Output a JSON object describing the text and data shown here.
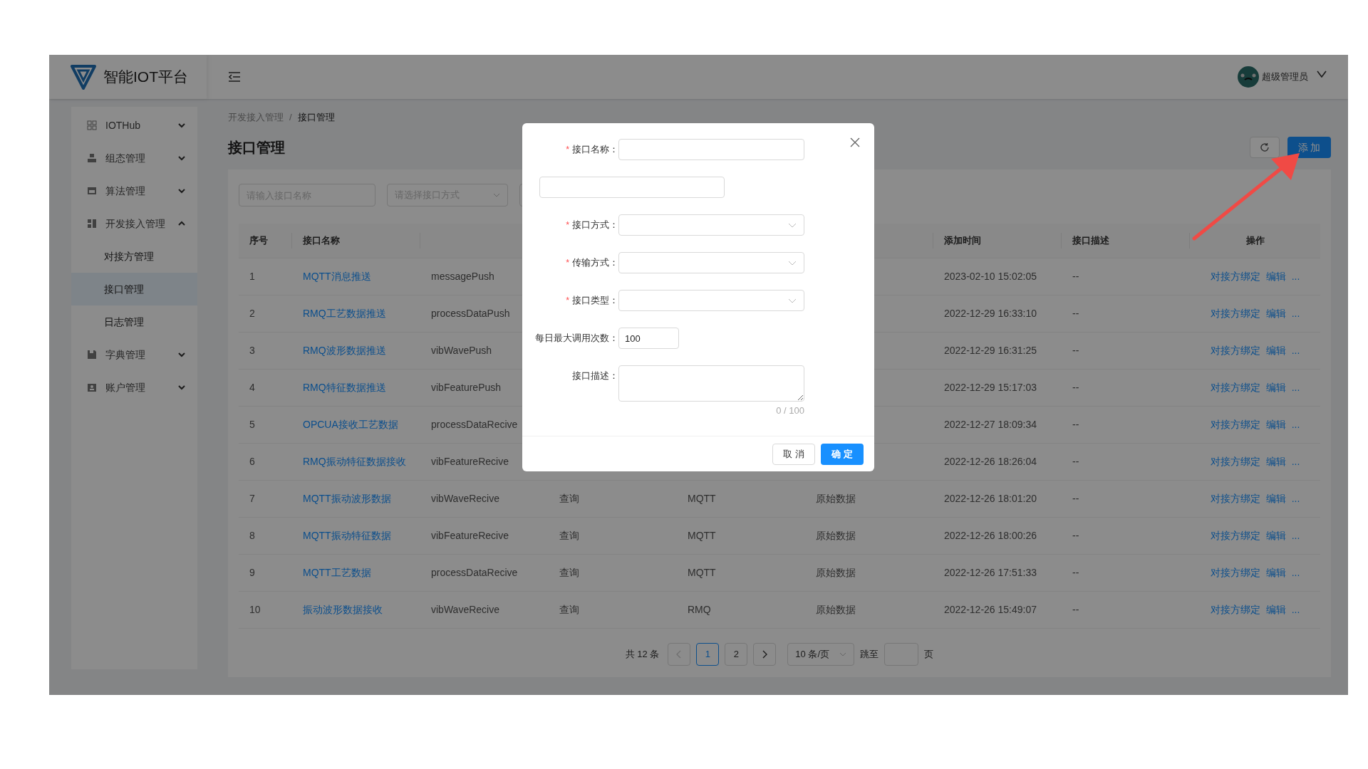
{
  "header": {
    "title": "智能IOT平台",
    "user": "超级管理员"
  },
  "sidebar": {
    "items": [
      {
        "label": "IOTHub",
        "expanded": false
      },
      {
        "label": "组态管理",
        "expanded": false
      },
      {
        "label": "算法管理",
        "expanded": false
      },
      {
        "label": "开发接入管理",
        "expanded": true,
        "children": [
          {
            "label": "对接方管理",
            "selected": false
          },
          {
            "label": "接口管理",
            "selected": true
          },
          {
            "label": "日志管理",
            "selected": false
          }
        ]
      },
      {
        "label": "字典管理",
        "expanded": false
      },
      {
        "label": "账户管理",
        "expanded": false
      }
    ]
  },
  "breadcrumb": {
    "items": [
      "开发接入管理",
      "接口管理"
    ],
    "separator": "/"
  },
  "page_title": "接口管理",
  "toolbar": {
    "add_button": "添 加"
  },
  "filters": [
    {
      "kind": "input",
      "placeholder": "请输入接口名称"
    },
    {
      "kind": "select",
      "placeholder": "请选择接口方式"
    }
  ],
  "table": {
    "columns": [
      "序号",
      "接口名称",
      null,
      null,
      null,
      null,
      "添加时间",
      "接口描述",
      "操作"
    ],
    "rows": [
      {
        "cells": [
          "1",
          "MQTT消息推送",
          "messagePush",
          null,
          null,
          null,
          "2023-02-10 15:02:05",
          "--"
        ],
        "actions": [
          "对接方绑定",
          "编辑",
          "..."
        ]
      },
      {
        "cells": [
          "2",
          "RMQ工艺数据推送",
          "processDataPush",
          null,
          null,
          null,
          "2022-12-29 16:33:10",
          "--"
        ],
        "actions": [
          "对接方绑定",
          "编辑",
          "..."
        ]
      },
      {
        "cells": [
          "3",
          "RMQ波形数据推送",
          "vibWavePush",
          null,
          null,
          null,
          "2022-12-29 16:31:25",
          "--"
        ],
        "actions": [
          "对接方绑定",
          "编辑",
          "..."
        ]
      },
      {
        "cells": [
          "4",
          "RMQ特征数据推送",
          "vibFeaturePush",
          null,
          null,
          null,
          "2022-12-29 15:17:03",
          "--"
        ],
        "actions": [
          "对接方绑定",
          "编辑",
          "..."
        ]
      },
      {
        "cells": [
          "5",
          "OPCUA接收工艺数据",
          "processDataRecive",
          null,
          null,
          null,
          "2022-12-27 18:09:34",
          "--"
        ],
        "actions": [
          "对接方绑定",
          "编辑",
          "..."
        ]
      },
      {
        "cells": [
          "6",
          "RMQ振动特征数据接收",
          "vibFeatureRecive",
          null,
          null,
          null,
          "2022-12-26 18:26:04",
          "--"
        ],
        "actions": [
          "对接方绑定",
          "编辑",
          "..."
        ]
      },
      {
        "cells": [
          "7",
          "MQTT振动波形数据",
          "vibWaveRecive",
          "查询",
          "MQTT",
          "原始数据",
          "2022-12-26 18:01:20",
          "--"
        ],
        "actions": [
          "对接方绑定",
          "编辑",
          "..."
        ]
      },
      {
        "cells": [
          "8",
          "MQTT振动特征数据",
          "vibFeatureRecive",
          "查询",
          "MQTT",
          "原始数据",
          "2022-12-26 18:00:26",
          "--"
        ],
        "actions": [
          "对接方绑定",
          "编辑",
          "..."
        ]
      },
      {
        "cells": [
          "9",
          "MQTT工艺数据",
          "processDataRecive",
          "查询",
          "MQTT",
          "原始数据",
          "2022-12-26 17:51:33",
          "--"
        ],
        "actions": [
          "对接方绑定",
          "编辑",
          "..."
        ]
      },
      {
        "cells": [
          "10",
          "振动波形数据接收",
          "vibWaveRecive",
          "查询",
          "RMQ",
          "原始数据",
          "2022-12-26 15:49:07",
          "--"
        ],
        "actions": [
          "对接方绑定",
          "编辑",
          "..."
        ]
      }
    ]
  },
  "pagination": {
    "total": "共 12 条",
    "prev": {
      "disabled": true
    },
    "next": {
      "disabled": false
    },
    "pages": [
      {
        "label": "1",
        "selected": true
      },
      {
        "label": "2",
        "selected": false
      }
    ],
    "page_size": "10 条/页",
    "jump_label": "跳至",
    "jump_suffix": "页"
  },
  "modal": {
    "fields": [
      {
        "kind": "input",
        "label": "接口名称：",
        "required_mark": "*"
      },
      {
        "kind": "loose_input"
      },
      {
        "kind": "select",
        "label": "接口方式：",
        "required_mark": "*"
      },
      {
        "kind": "select",
        "label": "传输方式：",
        "required_mark": "*"
      },
      {
        "kind": "select",
        "label": "接口类型：",
        "required_mark": "*"
      },
      {
        "kind": "number",
        "label": "每日最大调用次数：",
        "value": "100"
      },
      {
        "kind": "textarea",
        "label": "接口描述：",
        "counter": "0 / 100"
      }
    ],
    "cancel": "取 消",
    "confirm": "确 定"
  }
}
